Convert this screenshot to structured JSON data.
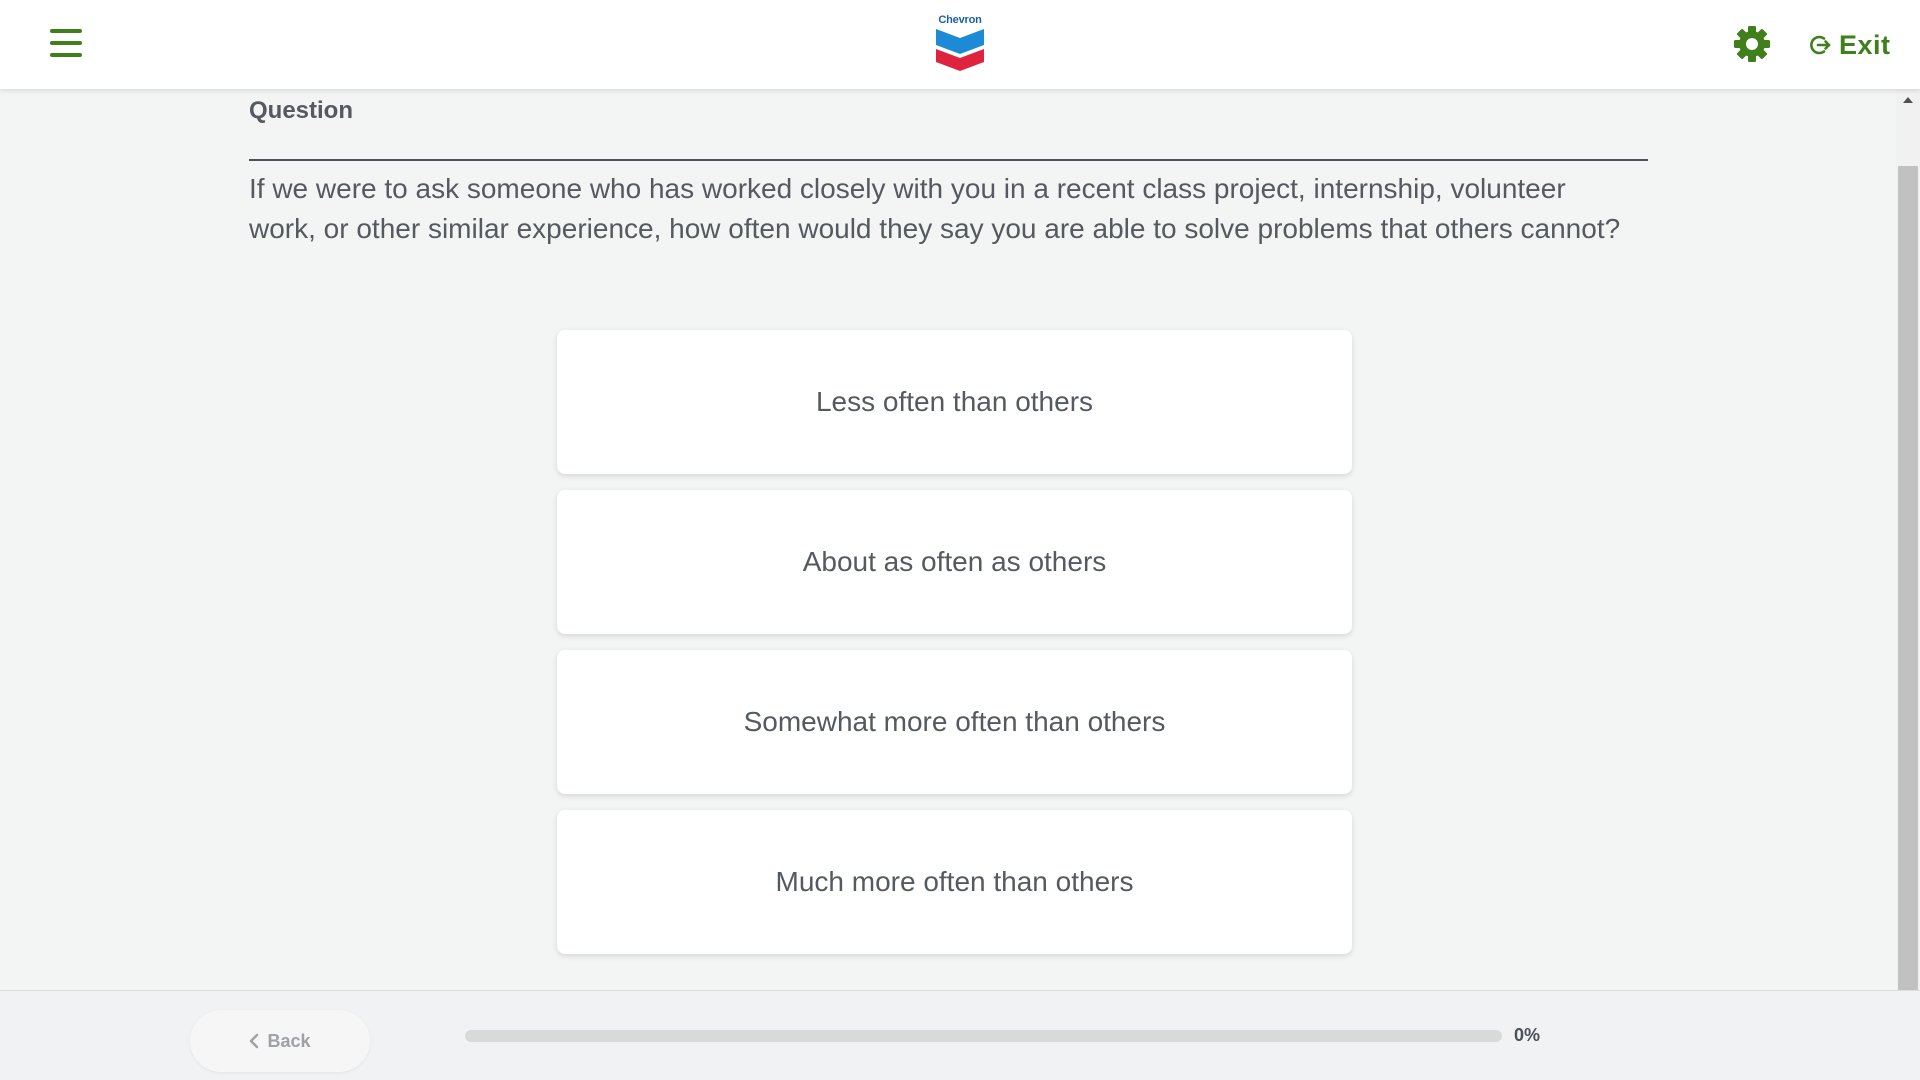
{
  "header": {
    "brand": "Chevron",
    "exit_label": "Exit",
    "icons": {
      "menu": "hamburger-menu-icon",
      "settings": "gear-icon",
      "exit": "exit-arrow-icon"
    },
    "accent_color": "#3f7f1c"
  },
  "question": {
    "heading": "Question",
    "text": "If we were to ask someone who has worked closely with you in a recent class project, internship, volunteer work, or other similar experience, how often would they say you are able to solve problems that others cannot?"
  },
  "options": [
    {
      "label": "Less often than others"
    },
    {
      "label": "About as often as others"
    },
    {
      "label": "Somewhat more often than others"
    },
    {
      "label": "Much more often than others"
    }
  ],
  "footer": {
    "back_label": "Back",
    "progress_percent": 0,
    "progress_label": "0%"
  }
}
